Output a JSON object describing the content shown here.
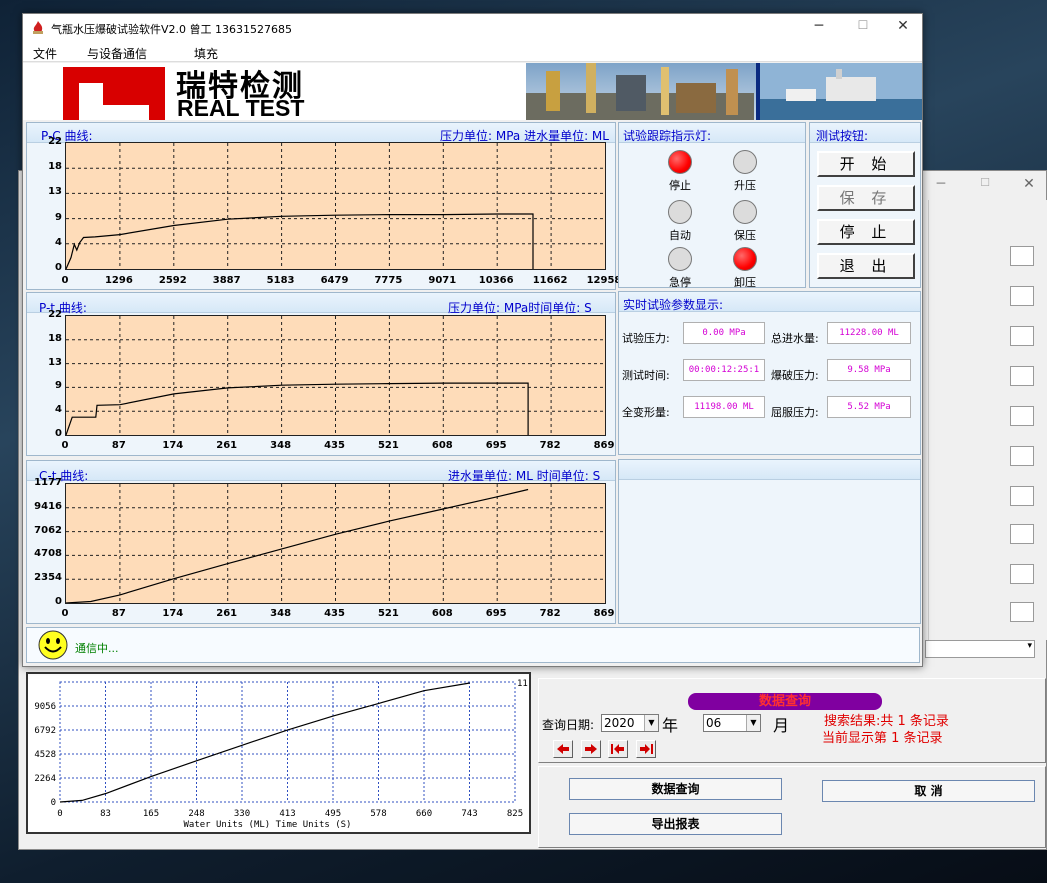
{
  "window": {
    "title": "气瓶水压爆破试验软件V2.0 曾工  13631527685",
    "minimize": "─",
    "maximize": "☐",
    "close": "✕"
  },
  "menu": {
    "items": [
      "文件",
      "与设备通信",
      "填充"
    ]
  },
  "banner": {
    "logo_cn": "瑞特检测",
    "logo_en": "REAL TEST"
  },
  "pc_chart": {
    "title": "P-C 曲线:",
    "units": "压力单位: MPa 进水量单位: ML"
  },
  "pt_chart": {
    "title": "P-t 曲线:",
    "units": "压力单位: MPa时间单位: S"
  },
  "ct_chart": {
    "title": "C-t 曲线:",
    "units": "进水量单位: ML 时间单位: S"
  },
  "indicators": {
    "title": "试验跟踪指示灯:",
    "lamps": [
      {
        "label": "停止",
        "on": true
      },
      {
        "label": "升压",
        "on": false
      },
      {
        "label": "自动",
        "on": false
      },
      {
        "label": "保压",
        "on": false
      },
      {
        "label": "急停",
        "on": false
      },
      {
        "label": "卸压",
        "on": true
      }
    ]
  },
  "test_buttons": {
    "title": "测试按钮:",
    "start": "开 始",
    "save": "保 存",
    "stop": "停 止",
    "exit": "退 出"
  },
  "params": {
    "title": "实时试验参数显示:",
    "test_pressure_label": "试验压力:",
    "test_pressure": "0.00 MPa",
    "total_water_label": "总进水量:",
    "total_water": "11228.00 ML",
    "test_time_label": "测试时间:",
    "test_time": "00:00:12:25:1",
    "burst_pressure_label": "爆破压力:",
    "burst_pressure": "9.58 MPa",
    "total_deform_label": "全变形量:",
    "total_deform": "11198.00 ML",
    "yield_pressure_label": "屈服压力:",
    "yield_pressure": "5.52 MPa"
  },
  "status": {
    "text": "通信中..."
  },
  "query": {
    "title": "数据查询",
    "date_label": "查询日期:",
    "year": "2020",
    "year_unit": "年",
    "month": "06",
    "month_unit": "月",
    "result_line1": "搜索结果:共 1 条记录",
    "result_line2": "当前显示第 1 条记录",
    "query_button": "数据查询",
    "export_button": "导出报表",
    "cancel_button": "取      消"
  },
  "bg_window": {
    "minimize": "─",
    "maximize": "☐",
    "close": "✕",
    "combo_arrow": "▾"
  },
  "bg_chart": {
    "xlabel": "Water Units (ML)       Time Units (S)",
    "corner_label": "11"
  },
  "chart_data": [
    {
      "id": "pc",
      "type": "line",
      "title": "P-C 曲线:",
      "xlabel": "进水量单位: ML",
      "ylabel": "压力单位: MPa",
      "xlim": [
        0,
        12958
      ],
      "ylim": [
        0,
        22
      ],
      "xticks": [
        "0",
        "1296",
        "2592",
        "3887",
        "5183",
        "6479",
        "7775",
        "9071",
        "10366",
        "11662",
        "12958"
      ],
      "yticks": [
        "0",
        "4",
        "9",
        "13",
        "18",
        "22"
      ],
      "series": [
        {
          "x": [
            0,
            120,
            200,
            260,
            330,
            420,
            700,
            1296,
            2592,
            3887,
            5183,
            6479,
            7775,
            9071,
            10366,
            11228,
            11228
          ],
          "y": [
            0,
            2,
            4.3,
            3.3,
            4.6,
            5.5,
            5.6,
            6,
            7.6,
            8.7,
            9.2,
            9.4,
            9.5,
            9.5,
            9.6,
            9.6,
            0
          ]
        }
      ]
    },
    {
      "id": "pt",
      "type": "line",
      "title": "P-t 曲线:",
      "xlabel": "时间单位: S",
      "ylabel": "压力单位: MPa",
      "xlim": [
        0,
        869
      ],
      "ylim": [
        0,
        22
      ],
      "xticks": [
        "0",
        "87",
        "174",
        "261",
        "348",
        "435",
        "521",
        "608",
        "695",
        "782",
        "869"
      ],
      "yticks": [
        "0",
        "4",
        "9",
        "13",
        "18",
        "22"
      ],
      "series": [
        {
          "x": [
            0,
            10,
            18,
            48,
            50,
            87,
            174,
            261,
            348,
            435,
            521,
            608,
            695,
            745,
            745
          ],
          "y": [
            0,
            3.3,
            3.3,
            3.3,
            5.5,
            5.6,
            7.6,
            8.7,
            9.2,
            9.4,
            9.5,
            9.6,
            9.6,
            9.6,
            0
          ]
        }
      ]
    },
    {
      "id": "ct",
      "type": "line",
      "title": "C-t 曲线:",
      "xlabel": "时间单位: S",
      "ylabel": "进水量单位: ML",
      "xlim": [
        0,
        869
      ],
      "ylim": [
        0,
        11770
      ],
      "xticks": [
        "0",
        "87",
        "174",
        "261",
        "348",
        "435",
        "521",
        "608",
        "695",
        "782",
        "869"
      ],
      "yticks": [
        "0",
        "2354",
        "4708",
        "7062",
        "9416",
        "1177"
      ],
      "series": [
        {
          "x": [
            0,
            40,
            87,
            174,
            261,
            348,
            435,
            521,
            608,
            695,
            745
          ],
          "y": [
            0,
            150,
            800,
            2400,
            3900,
            5350,
            6800,
            8100,
            9300,
            10500,
            11228
          ]
        }
      ]
    },
    {
      "id": "bg",
      "type": "line",
      "xlabel": "Water Units (ML)       Time Units (S)",
      "xlim": [
        0,
        825
      ],
      "ylim": [
        0,
        11320
      ],
      "xticks": [
        "0",
        "83",
        "165",
        "248",
        "330",
        "413",
        "495",
        "578",
        "660",
        "743",
        "825"
      ],
      "yticks": [
        "0",
        "2264",
        "4528",
        "6792",
        "9056"
      ],
      "series": [
        {
          "x": [
            0,
            40,
            83,
            165,
            248,
            330,
            413,
            495,
            578,
            660,
            743
          ],
          "y": [
            0,
            150,
            800,
            2400,
            3900,
            5350,
            6800,
            8100,
            9300,
            10500,
            11228
          ]
        }
      ]
    }
  ]
}
